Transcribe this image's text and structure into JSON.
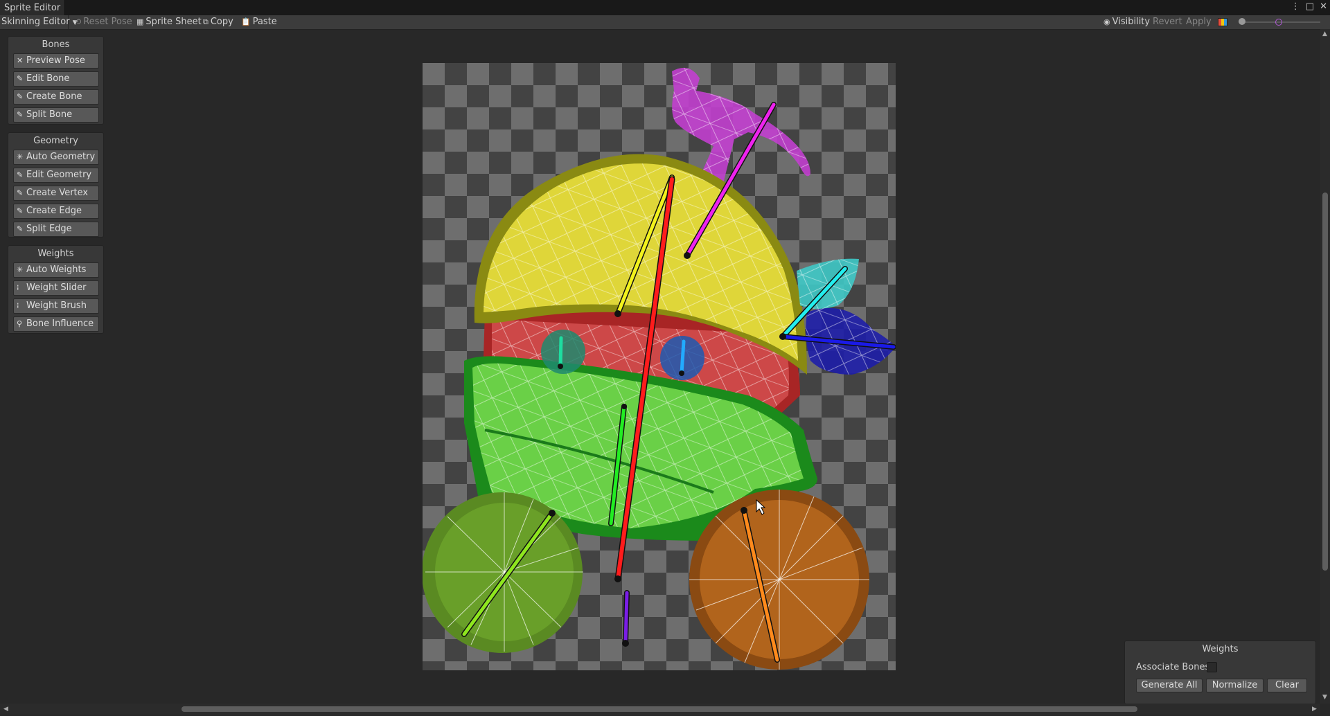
{
  "window": {
    "title": "Sprite Editor"
  },
  "toolbar": {
    "mode": "Skinning Editor",
    "reset_pose": "Reset Pose",
    "sprite_sheet": "Sprite Sheet",
    "copy": "Copy",
    "paste": "Paste",
    "visibility": "Visibility",
    "revert": "Revert",
    "apply": "Apply"
  },
  "panels": {
    "bones": {
      "title": "Bones",
      "tools": [
        "Preview Pose",
        "Edit Bone",
        "Create Bone",
        "Split Bone"
      ]
    },
    "geometry": {
      "title": "Geometry",
      "tools": [
        "Auto Geometry",
        "Edit Geometry",
        "Create Vertex",
        "Create Edge",
        "Split Edge"
      ]
    },
    "weights": {
      "title": "Weights",
      "tools": [
        "Auto Weights",
        "Weight Slider",
        "Weight Brush",
        "Bone Influence"
      ]
    }
  },
  "weights_panel": {
    "title": "Weights",
    "associate_label": "Associate Bones",
    "generate": "Generate All",
    "normalize": "Normalize",
    "clear": "Clear"
  },
  "colors": {
    "yellow": "#e4da3c",
    "red": "#cf4a4a",
    "green": "#6fd44a",
    "magenta": "#c23fcf",
    "cyan": "#3fc9c6",
    "navy": "#1e1ea8",
    "leaf_green": "#6aa02a",
    "orange": "#b3651e"
  }
}
